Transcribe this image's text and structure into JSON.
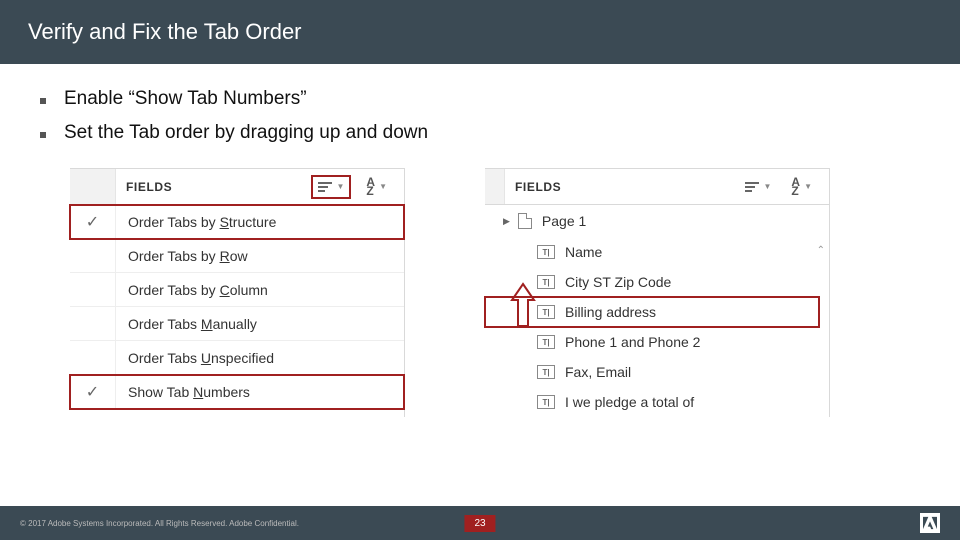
{
  "title": "Verify and Fix the Tab Order",
  "bullets": [
    "Enable “Show Tab Numbers”",
    "Set the Tab order by dragging up and down"
  ],
  "panel_left": {
    "header": "FIELDS",
    "sort_label": "A\nZ",
    "menu": [
      {
        "checked": true,
        "label_pre": "Order Tabs by ",
        "u": "S",
        "label_post": "tructure",
        "highlight": true
      },
      {
        "checked": false,
        "label_pre": "Order Tabs by ",
        "u": "R",
        "label_post": "ow",
        "highlight": false
      },
      {
        "checked": false,
        "label_pre": "Order Tabs by ",
        "u": "C",
        "label_post": "olumn",
        "highlight": false
      },
      {
        "checked": false,
        "label_pre": "Order Tabs ",
        "u": "M",
        "label_post": "anually",
        "highlight": false
      },
      {
        "checked": false,
        "label_pre": "Order Tabs ",
        "u": "U",
        "label_post": "nspecified",
        "highlight": false
      },
      {
        "checked": true,
        "label_pre": "Show Tab ",
        "u": "N",
        "label_post": "umbers",
        "highlight": true
      }
    ]
  },
  "panel_right": {
    "header": "FIELDS",
    "sort_label": "A\nZ",
    "page_label": "Page 1",
    "fields": [
      {
        "label": "Name",
        "highlight": false
      },
      {
        "label": "City ST  Zip Code",
        "highlight": false
      },
      {
        "label": "Billing address",
        "highlight": true
      },
      {
        "label": "Phone 1  and Phone 2",
        "highlight": false
      },
      {
        "label": "Fax, Email",
        "highlight": false
      },
      {
        "label": "I we pledge a total of",
        "highlight": false
      }
    ]
  },
  "footer": {
    "copyright": "© 2017 Adobe Systems Incorporated.  All Rights Reserved.  Adobe Confidential.",
    "page": "23"
  },
  "colors": {
    "accent": "#a02020",
    "header": "#3b4a54"
  }
}
